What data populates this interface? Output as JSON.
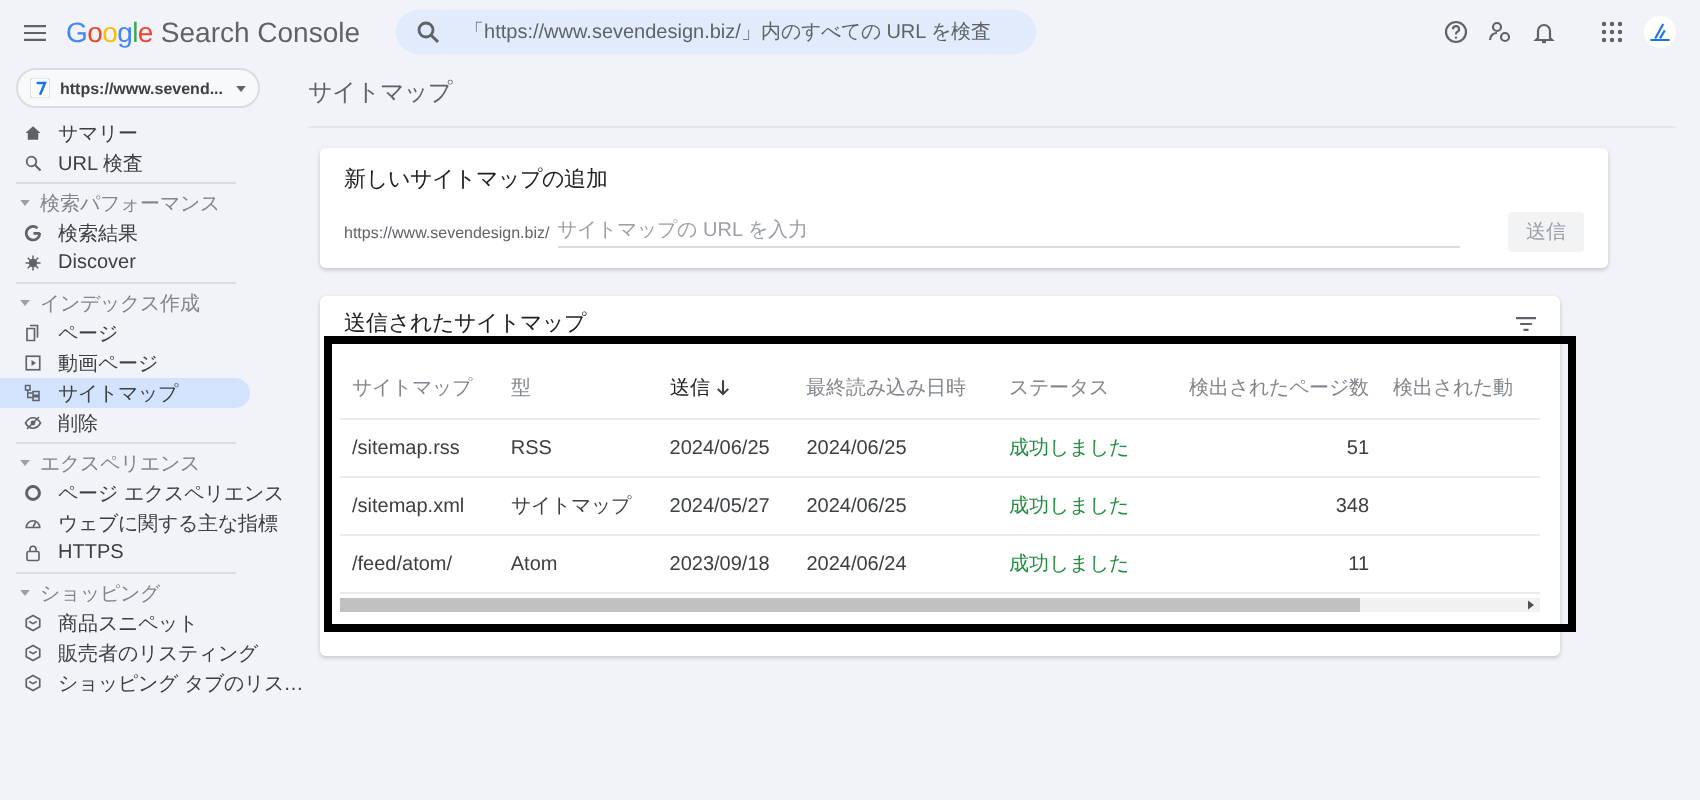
{
  "header": {
    "product_brand": "Google",
    "product_name": "Search Console",
    "search": {
      "placeholder": "「https://www.sevendesign.biz/」内のすべての URL を検査"
    }
  },
  "property_selector": {
    "value": "https://www.sevend..."
  },
  "sidebar": {
    "items": [
      {
        "kind": "item",
        "label": "サマリー",
        "selected": false
      },
      {
        "kind": "item",
        "label": "URL 検査",
        "selected": false
      },
      {
        "kind": "section",
        "label": "検索パフォーマンス",
        "expanded": true
      },
      {
        "kind": "item",
        "label": "検索結果",
        "selected": false
      },
      {
        "kind": "item",
        "label": "Discover",
        "selected": false
      },
      {
        "kind": "section",
        "label": "インデックス作成",
        "expanded": true
      },
      {
        "kind": "item",
        "label": "ページ",
        "selected": false
      },
      {
        "kind": "item",
        "label": "動画ページ",
        "selected": false
      },
      {
        "kind": "item",
        "label": "サイトマップ",
        "selected": true
      },
      {
        "kind": "item",
        "label": "削除",
        "selected": false
      },
      {
        "kind": "section",
        "label": "エクスペリエンス",
        "expanded": true
      },
      {
        "kind": "item",
        "label": "ページ エクスペリエンス",
        "selected": false
      },
      {
        "kind": "item",
        "label": "ウェブに関する主な指標",
        "selected": false
      },
      {
        "kind": "item",
        "label": "HTTPS",
        "selected": false
      },
      {
        "kind": "section",
        "label": "ショッピング",
        "expanded": true
      },
      {
        "kind": "item",
        "label": "商品スニペット",
        "selected": false
      },
      {
        "kind": "item",
        "label": "販売者のリスティング",
        "selected": false
      },
      {
        "kind": "item",
        "label": "ショッピング タブのリス…",
        "selected": false
      }
    ]
  },
  "page_title": "サイトマップ",
  "add_card": {
    "title": "新しいサイトマップの追加",
    "url_prefix": "https://www.sevendesign.biz/",
    "input": {
      "placeholder": "サイトマップの URL を入力"
    },
    "submit_button": {
      "label": "送信",
      "disabled": true
    }
  },
  "submitted_card": {
    "title": "送信されたサイトマップ",
    "table": {
      "columns": [
        {
          "label": "サイトマップ",
          "sorted": false
        },
        {
          "label": "型",
          "sorted": false
        },
        {
          "label": "送信",
          "sorted": true
        },
        {
          "label": "最終読み込み日時",
          "sorted": false
        },
        {
          "label": "ステータス",
          "sorted": false
        },
        {
          "label": "検出されたページ数",
          "sorted": false
        },
        {
          "label": "検出された動",
          "sorted": false
        }
      ],
      "rows": [
        {
          "cells": [
            "/sitemap.rss",
            "RSS",
            "2024/06/25",
            "2024/06/25",
            "成功しました",
            "51"
          ]
        },
        {
          "cells": [
            "/sitemap.xml",
            "サイトマップ",
            "2024/05/27",
            "2024/06/25",
            "成功しました",
            "348"
          ]
        },
        {
          "cells": [
            "/feed/atom/",
            "Atom",
            "2023/09/18",
            "2024/06/24",
            "成功しました",
            "11"
          ]
        }
      ]
    }
  }
}
